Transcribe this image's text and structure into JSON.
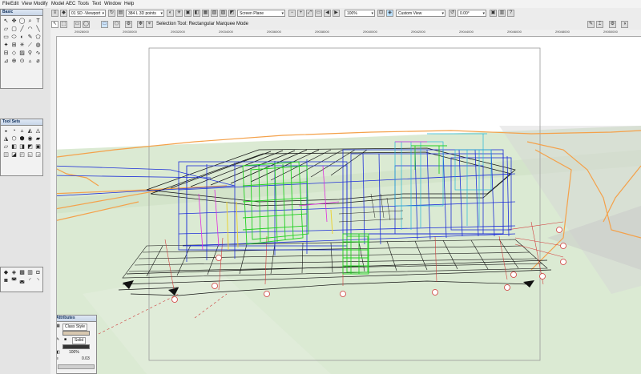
{
  "menu": [
    "File",
    "Edit",
    "View",
    "Modify",
    "Model",
    "AEC",
    "Tools",
    "Text",
    "Window",
    "Help"
  ],
  "toolbar": {
    "layer": "01 SD -Viewport",
    "scale": "384 L 3D points",
    "plane": "Screen Plane",
    "zoom": "100%",
    "view": "Custom View",
    "angle": "0.00°"
  },
  "mode_bar": {
    "status": "Selection Tool: Rectangular Marquee Mode"
  },
  "rulers": {
    "top": [
      "29028000",
      "29030000",
      "29032000",
      "29034000",
      "29036000",
      "29038000",
      "29040000",
      "29042000",
      "29044000",
      "29046000",
      "29048000",
      "29050000"
    ]
  },
  "palettes": {
    "basic": "Basic",
    "tool_sets": "Tool Sets",
    "attributes": {
      "title": "Attributes",
      "fill_style": "Class Style",
      "pen_style": "Solid",
      "opacity": "100%",
      "line_weight": "0.03"
    }
  },
  "scene": {
    "grid_labels": [
      "A",
      "B",
      "C",
      "D",
      "E",
      "F",
      "G",
      "1",
      "2",
      "3",
      "4",
      "5"
    ],
    "colors": {
      "sky": "#ffffff",
      "ground": "#dbead3",
      "terrain_line": "#f4a14a",
      "wire_blue": "#1e2fd8",
      "wire_green": "#22d022",
      "wire_cyan": "#22b8d8",
      "wire_magenta": "#e02ce0",
      "wire_yellow": "#ead235",
      "gridline_red": "#d23a3a"
    }
  }
}
